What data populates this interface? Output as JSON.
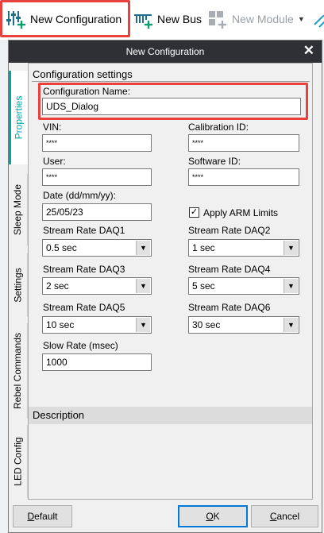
{
  "toolbar": {
    "new_configuration_label": "New Configuration",
    "new_bus_label": "New Bus",
    "new_module_label": "New Module",
    "highlight_color": "#e8413e"
  },
  "dialog": {
    "title": "New Configuration",
    "close_glyph": "✕",
    "tabs": [
      "Properties",
      "Sleep Mode",
      "Settings",
      "Rebel Commands",
      "LED Config"
    ],
    "active_tab": "Properties",
    "accent_color": "#00a6a6",
    "section_title": "Configuration settings",
    "fields": {
      "config_name": {
        "label": "Configuration Name:",
        "value": "UDS_Dialog"
      },
      "vin": {
        "label": "VIN:",
        "value": "****"
      },
      "calibration_id": {
        "label": "Calibration ID:",
        "value": "****"
      },
      "user": {
        "label": "User:",
        "value": "****"
      },
      "software_id": {
        "label": "Software ID:",
        "value": "****"
      },
      "date": {
        "label": "Date (dd/mm/yy):",
        "value": "25/05/23"
      },
      "apply_arm": {
        "label": "Apply ARM Limits",
        "checked": true
      },
      "daq1": {
        "label": "Stream Rate DAQ1",
        "value": "0.5 sec"
      },
      "daq2": {
        "label": "Stream Rate DAQ2",
        "value": "1 sec"
      },
      "daq3": {
        "label": "Stream Rate DAQ3",
        "value": "2 sec"
      },
      "daq4": {
        "label": "Stream Rate DAQ4",
        "value": "5 sec"
      },
      "daq5": {
        "label": "Stream Rate DAQ5",
        "value": "10 sec"
      },
      "daq6": {
        "label": "Stream Rate DAQ6",
        "value": "30 sec"
      },
      "slow_rate": {
        "label": "Slow Rate (msec)",
        "value": "1000"
      }
    },
    "description_title": "Description",
    "buttons": {
      "default_pre": "",
      "default_u": "D",
      "default_post": "efault",
      "ok_u": "O",
      "ok_post": "K",
      "cancel_u": "C",
      "cancel_post": "ancel"
    }
  }
}
